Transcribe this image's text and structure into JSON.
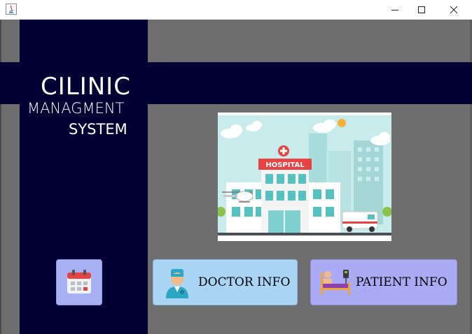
{
  "window": {
    "app_icon": "java-app-icon",
    "controls": [
      "minimize-icon",
      "maximize-icon",
      "close-icon"
    ]
  },
  "logo": {
    "title": "CILINIC",
    "subtitle_line1": "MANAGMENT",
    "subtitle_line2": "SYSTEM"
  },
  "hero": {
    "sign_text": "HOSPITAL"
  },
  "buttons": {
    "calendar": {
      "icon": "calendar-icon"
    },
    "doctor": {
      "label": "DOCTOR INFO",
      "icon": "doctor-icon"
    },
    "patient": {
      "label": "PATIENT INFO",
      "icon": "patient-bed-icon"
    }
  },
  "colors": {
    "navy": "#000033",
    "background": "#6e6e6e",
    "doctor_button": "#aad4f4",
    "patient_button": "#ababf5",
    "calendar_button": "#a8b0f4"
  }
}
